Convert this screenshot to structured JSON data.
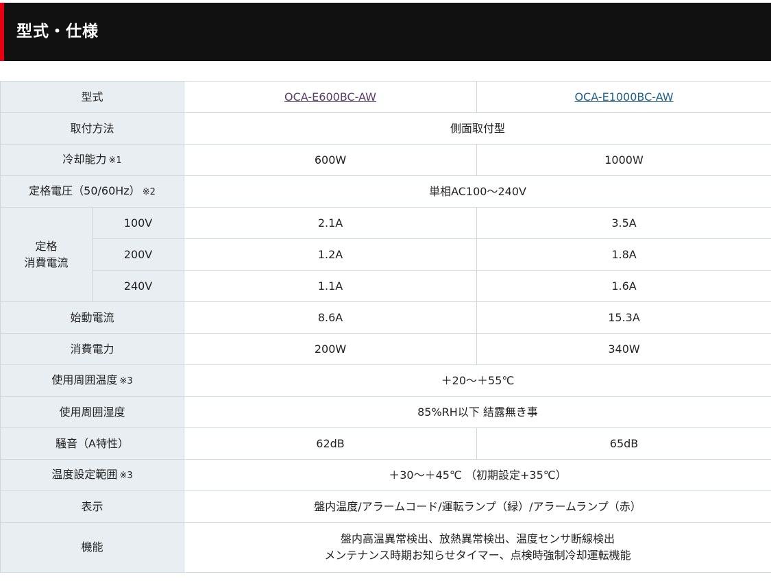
{
  "header": {
    "title": "型式・仕様"
  },
  "models": [
    {
      "name": "OCA-E600BC-AW"
    },
    {
      "name": "OCA-E1000BC-AW"
    }
  ],
  "rows": {
    "model": {
      "label": "型式"
    },
    "mounting": {
      "label": "取付方法",
      "value": "側面取付型"
    },
    "cooling": {
      "label": "冷却能力",
      "note": "※1",
      "values": [
        "600W",
        "1000W"
      ]
    },
    "voltage": {
      "label": "定格電圧（50/60Hz）",
      "note": "※2",
      "value": "単相AC100～240V"
    },
    "current": {
      "label_line1": "定格",
      "label_line2": "消費電流",
      "sub": [
        {
          "voltage": "100V",
          "values": [
            "2.1A",
            "3.5A"
          ]
        },
        {
          "voltage": "200V",
          "values": [
            "1.2A",
            "1.8A"
          ]
        },
        {
          "voltage": "240V",
          "values": [
            "1.1A",
            "1.6A"
          ]
        }
      ]
    },
    "starting_current": {
      "label": "始動電流",
      "values": [
        "8.6A",
        "15.3A"
      ]
    },
    "power": {
      "label": "消費電力",
      "values": [
        "200W",
        "340W"
      ]
    },
    "ambient_temp": {
      "label": "使用周囲温度",
      "note": "※3",
      "value": "＋20～＋55℃"
    },
    "ambient_humidity": {
      "label": "使用周囲湿度",
      "value": "85%RH以下 結露無き事"
    },
    "noise": {
      "label": "騒音（A特性）",
      "values": [
        "62dB",
        "65dB"
      ]
    },
    "temp_range": {
      "label": "温度設定範囲",
      "note": "※3",
      "value": "＋30～＋45℃ （初期設定+35℃）"
    },
    "display": {
      "label": "表示",
      "value": "盤内温度/アラームコード/運転ランプ（緑）/アラームランプ（赤）"
    },
    "function": {
      "label": "機能",
      "line1": "盤内高温異常検出、放熱異常検出、温度センサ断線検出",
      "line2": "メンテナンス時期お知らせタイマー、点検時強制冷却運転機能"
    }
  }
}
